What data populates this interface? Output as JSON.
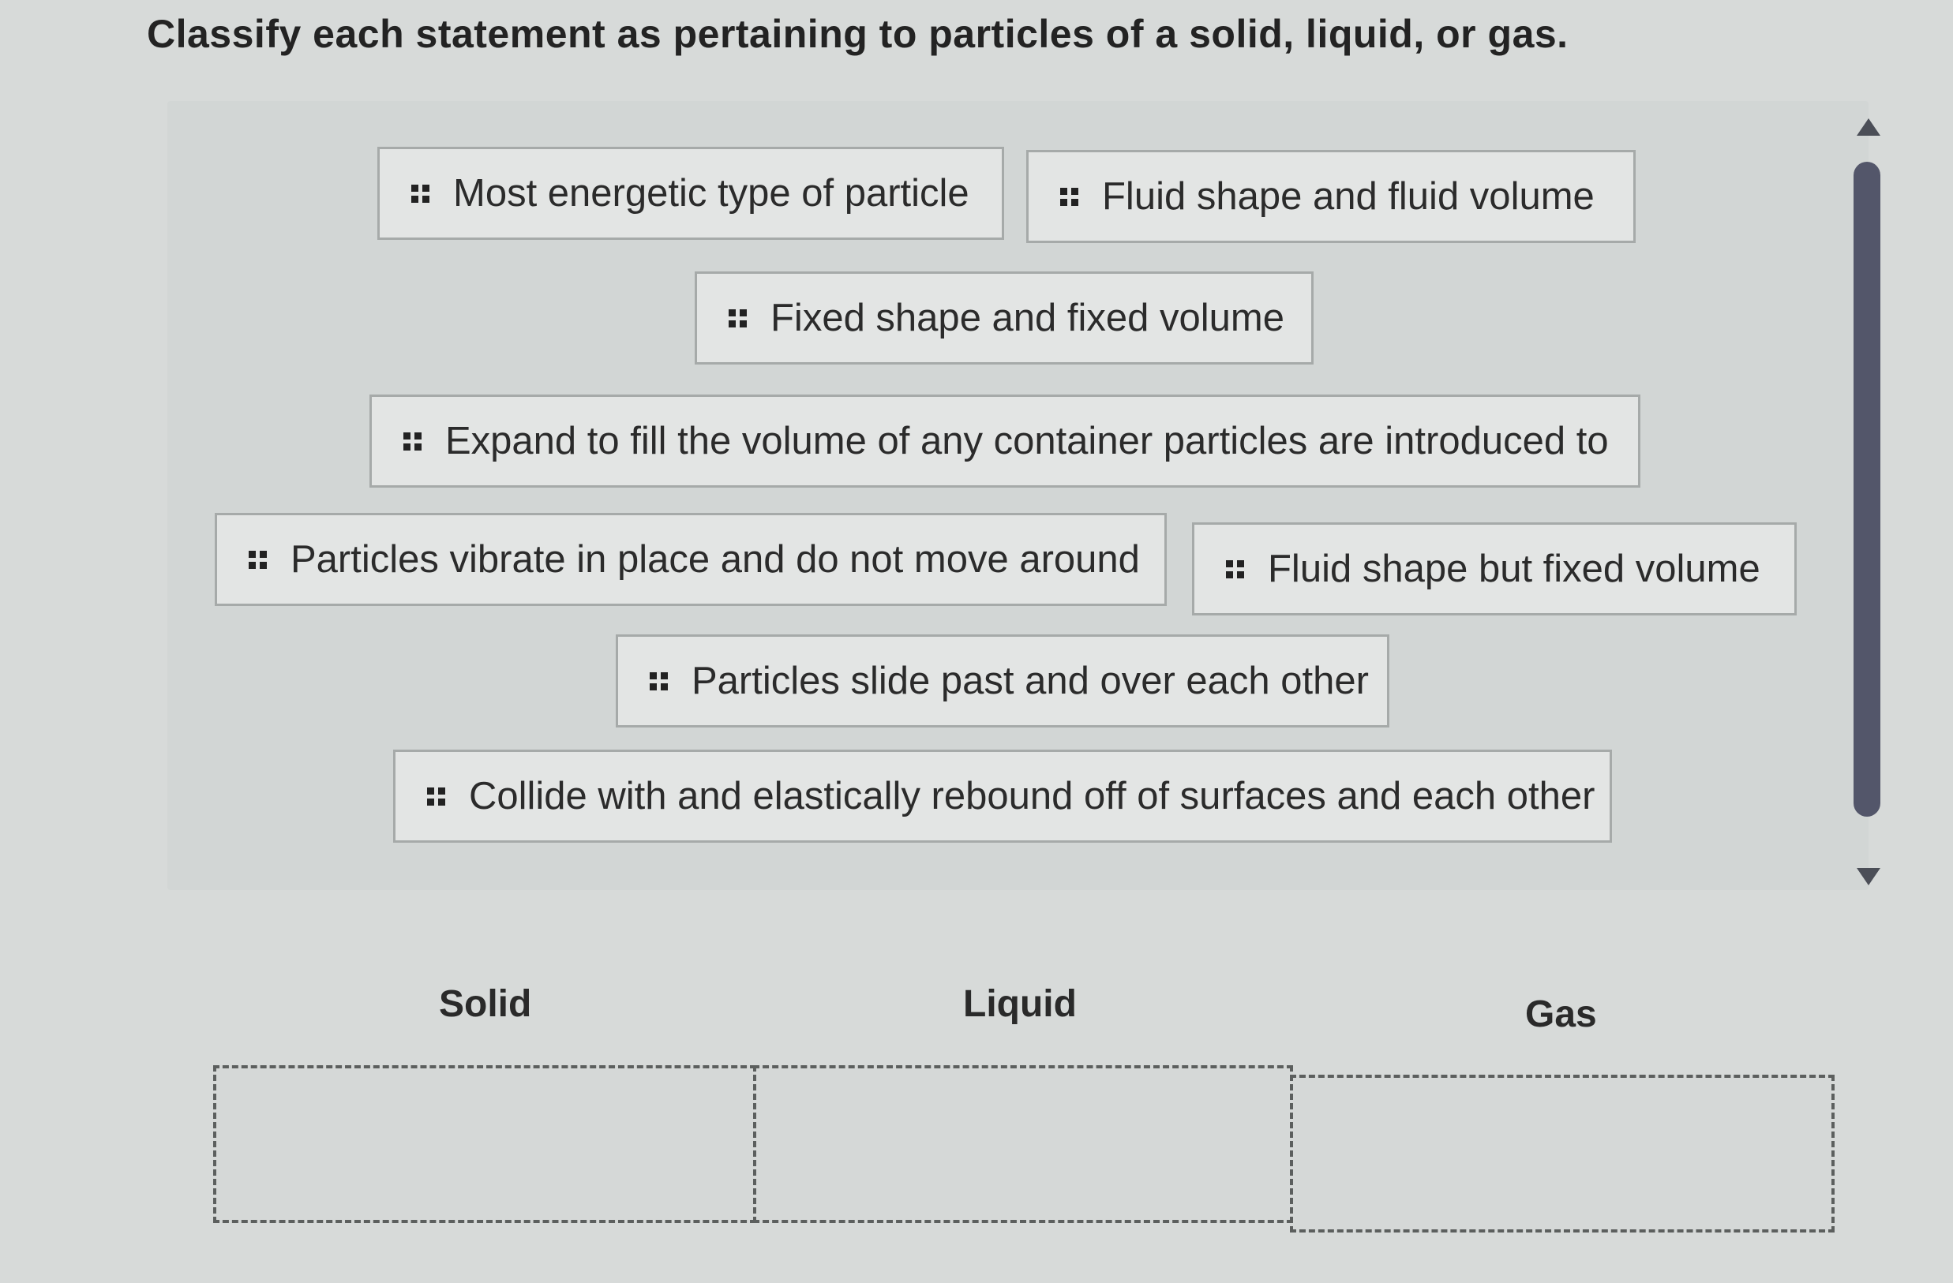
{
  "question": "Classify each statement as pertaining to particles of a solid, liquid, or gas.",
  "items": [
    "Most energetic type of particle",
    "Fluid shape and fluid volume",
    "Fixed shape and fixed volume",
    "Expand to fill the volume of any container particles are introduced to",
    "Particles vibrate in place and do not move around",
    "Fluid shape but fixed volume",
    "Particles slide past and over each other",
    "Collide with and elastically rebound off of surfaces and each other"
  ],
  "categories": [
    "Solid",
    "Liquid",
    "Gas"
  ],
  "icons": {
    "drag_handle": "drag-handle-icon",
    "scroll_up": "scroll-up-arrow-icon",
    "scroll_down": "scroll-down-arrow-icon"
  }
}
